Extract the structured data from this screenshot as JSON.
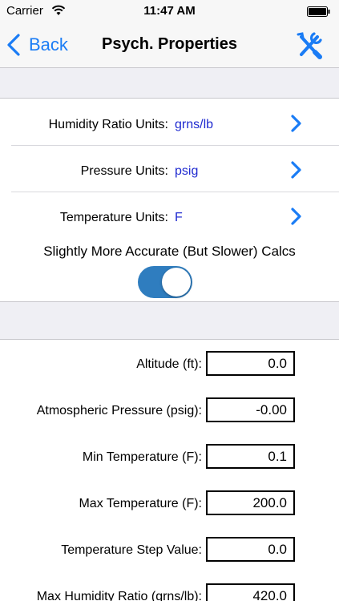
{
  "status_bar": {
    "carrier": "Carrier",
    "time": "11:47 AM"
  },
  "nav": {
    "back_label": "Back",
    "title": "Psych. Properties"
  },
  "units": [
    {
      "label": "Humidity Ratio Units:",
      "value": "grns/lb"
    },
    {
      "label": "Pressure Units:",
      "value": "psig"
    },
    {
      "label": "Temperature Units:",
      "value": "F"
    }
  ],
  "accuracy_toggle": {
    "label": "Slightly More Accurate (But Slower) Calcs",
    "on": true
  },
  "fields": [
    {
      "label": "Altitude (ft):",
      "value": "0.0"
    },
    {
      "label": "Atmospheric Pressure (psig):",
      "value": "-0.00"
    },
    {
      "label": "Min Temperature (F):",
      "value": "0.1"
    },
    {
      "label": "Max Temperature (F):",
      "value": "200.0"
    },
    {
      "label": "Temperature Step Value:",
      "value": "0.0"
    },
    {
      "label": "Max Humidity Ratio (grns/lb):",
      "value": "420.0"
    }
  ],
  "colors": {
    "accent": "#1a7cf5",
    "unit_value": "#1f2ad0",
    "toggle_on": "#2f7dbf",
    "group_bg": "#efeff4"
  }
}
